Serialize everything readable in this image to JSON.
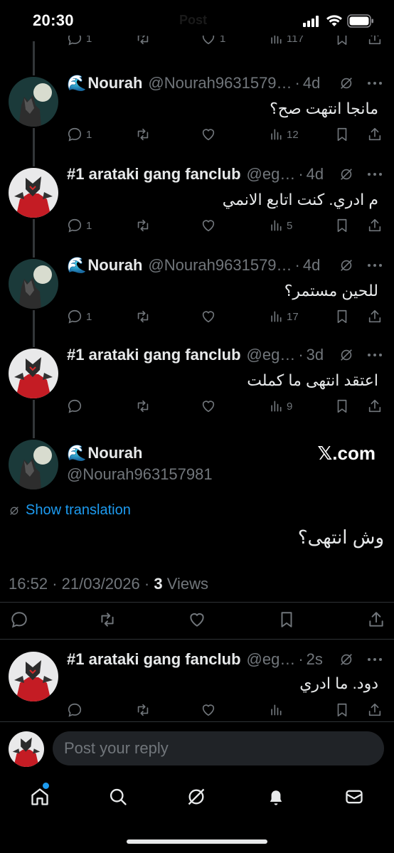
{
  "status": {
    "time": "20:30",
    "ghost_title": "Post"
  },
  "tweets": [
    {
      "display_name": "Nourah",
      "emoji": "🌊",
      "handle": "@Nourah9631579…",
      "age": "4d",
      "text": "مانجا انتهت صح؟",
      "replies": "1",
      "retweets": "",
      "likes": "",
      "views": "12"
    },
    {
      "display_name": "#1 arataki gang fanclub",
      "emoji": "",
      "handle": "@eg…",
      "age": "4d",
      "text": "م ادري. كنت اتابع الانمي",
      "replies": "1",
      "retweets": "",
      "likes": "",
      "views": "5"
    },
    {
      "display_name": "Nourah",
      "emoji": "🌊",
      "handle": "@Nourah9631579…",
      "age": "4d",
      "text": "للحين مستمر؟",
      "replies": "1",
      "retweets": "",
      "likes": "",
      "views": "17"
    },
    {
      "display_name": "#1 arataki gang fanclub",
      "emoji": "",
      "handle": "@eg…",
      "age": "3d",
      "text": "اعتقد انتهى ما كملت",
      "replies": "",
      "retweets": "",
      "likes": "",
      "views": "9"
    }
  ],
  "top_partial": {
    "replies": "1",
    "likes": "1",
    "views": "117"
  },
  "main_post": {
    "display_name": "Nourah",
    "emoji": "🌊",
    "handle": "@Nourah963157981",
    "source": "𝕏.com",
    "translate_label": "Show translation",
    "text": "وش انتهى؟",
    "time": "16:52",
    "date": "21/03/2026",
    "views_count": "3",
    "views_label": "Views"
  },
  "reply_tweet": {
    "display_name": "#1 arataki gang fanclub",
    "handle": "@eg…",
    "age": "2s",
    "text": "دود. ما ادري"
  },
  "composer": {
    "placeholder": "Post your reply"
  },
  "tabs": [
    "home",
    "search",
    "grok",
    "notifications",
    "messages"
  ],
  "colors": {
    "accent": "#1d9bf0",
    "muted": "#71767b",
    "text": "#e7e9ea",
    "bg": "#000000"
  }
}
